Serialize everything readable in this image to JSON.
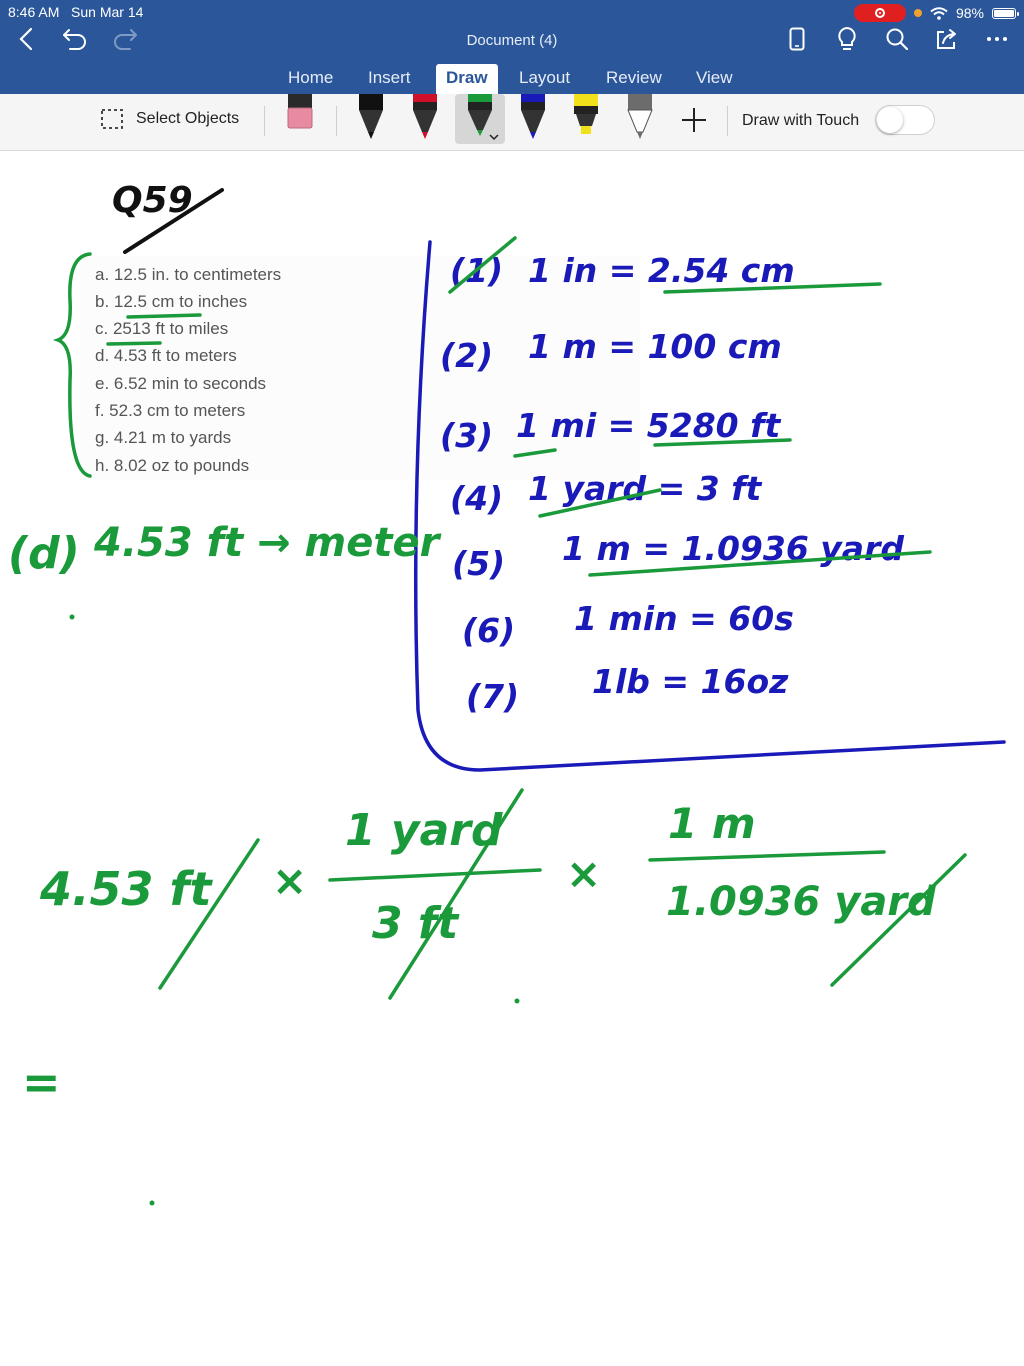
{
  "status_bar": {
    "time": "8:46 AM",
    "date": "Sun Mar 14",
    "battery": "98%",
    "battery_level": 0.98
  },
  "document": {
    "title": "Document (4)"
  },
  "tabs": [
    {
      "label": "Home"
    },
    {
      "label": "Insert"
    },
    {
      "label": "Draw",
      "active": true
    },
    {
      "label": "Layout"
    },
    {
      "label": "Review"
    },
    {
      "label": "View"
    }
  ],
  "ribbon": {
    "select_objects": "Select Objects",
    "draw_with_touch": "Draw with Touch",
    "draw_with_touch_on": false,
    "tools": [
      {
        "name": "eraser",
        "color": "#e88aa0"
      },
      {
        "name": "pen-black",
        "color": "#111111"
      },
      {
        "name": "pen-red",
        "color": "#d0102a"
      },
      {
        "name": "pen-green",
        "color": "#1a9a3a",
        "selected": true
      },
      {
        "name": "pen-blue",
        "color": "#1a1ab8"
      },
      {
        "name": "highlighter-yellow",
        "color": "#f2e01a"
      },
      {
        "name": "pencil-gray",
        "color": "#6c6c6c"
      }
    ]
  },
  "questions": [
    "a. 12.5 in. to centimeters",
    "b. 12.5 cm to inches",
    "c. 2513 ft to miles",
    "d. 4.53 ft to meters",
    "e. 6.52 min to seconds",
    "f. 52.3 cm to meters",
    "g. 4.21 m to yards",
    "h. 8.02 oz to pounds"
  ],
  "ink_colors": {
    "green": "#1a9a3a",
    "blue": "#1a1ab8",
    "black": "#111111"
  },
  "handwriting": {
    "question_number": "Q59",
    "problem": {
      "label": "(d)",
      "text": "4.53 ft → meter"
    },
    "conversions": [
      {
        "num": "(1)",
        "text": "1 in = 2.54 cm"
      },
      {
        "num": "(2)",
        "text": "1 m = 100 cm"
      },
      {
        "num": "(3)",
        "text": "1 mi = 5280 ft"
      },
      {
        "num": "(4)",
        "text": "1 yard = 3 ft"
      },
      {
        "num": "(5)",
        "text": "1 m = 1.0936 yard"
      },
      {
        "num": "(6)",
        "text": "1 min = 60s"
      },
      {
        "num": "(7)",
        "text": "1lb = 16oz"
      }
    ],
    "equation": {
      "lhs": "4.53 ft",
      "times": "×",
      "f1_num": "1 yard",
      "f1_den": "3 ft",
      "f2_num": "1 m",
      "f2_den": "1.0936 yard",
      "equals": "="
    }
  }
}
